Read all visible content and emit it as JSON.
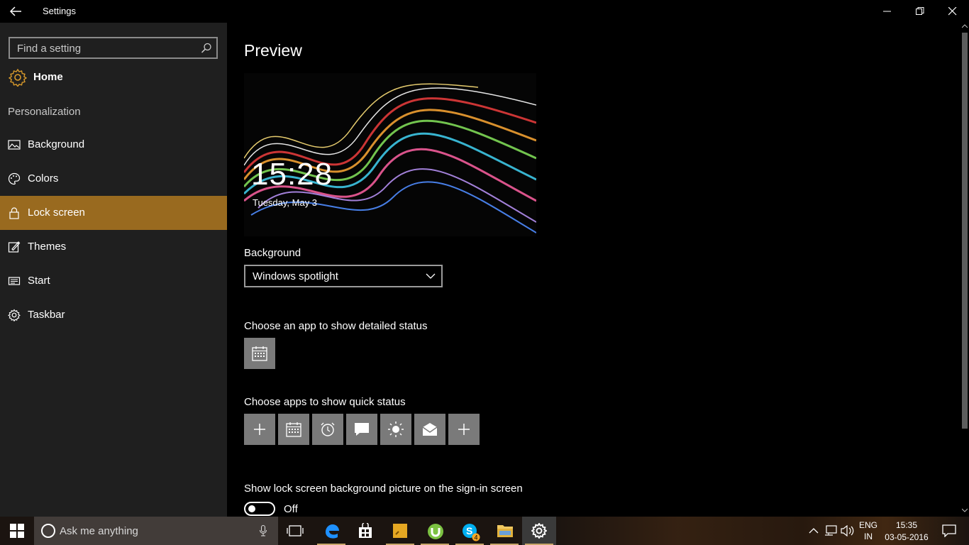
{
  "window": {
    "title": "Settings"
  },
  "sidebar": {
    "search_placeholder": "Find a setting",
    "home_label": "Home",
    "section_label": "Personalization",
    "items": [
      {
        "label": "Background",
        "icon": "image-icon"
      },
      {
        "label": "Colors",
        "icon": "palette-icon"
      },
      {
        "label": "Lock screen",
        "icon": "lock-icon",
        "active": true
      },
      {
        "label": "Themes",
        "icon": "brush-icon"
      },
      {
        "label": "Start",
        "icon": "start-icon"
      },
      {
        "label": "Taskbar",
        "icon": "taskbar-icon"
      }
    ]
  },
  "content": {
    "preview_heading": "Preview",
    "preview_time": "15:28",
    "preview_date": "Tuesday, May 3",
    "background_label": "Background",
    "background_value": "Windows spotlight",
    "detailed_status_label": "Choose an app to show detailed status",
    "quick_status_label": "Choose apps to show quick status",
    "quick_status_apps": [
      "add-icon",
      "calendar-icon",
      "alarm-icon",
      "message-icon",
      "weather-icon",
      "mail-icon",
      "add-icon"
    ],
    "signin_label": "Show lock screen background picture on the sign-in screen",
    "signin_toggle": "Off"
  },
  "taskbar": {
    "search_placeholder": "Ask me anything",
    "language": "ENG",
    "region": "IN",
    "time": "15:35",
    "date": "03-05-2016",
    "skype_badge": "4"
  },
  "colors": {
    "accent": "#996a1f",
    "sidebar": "#1f1f1f",
    "content": "#000000"
  }
}
